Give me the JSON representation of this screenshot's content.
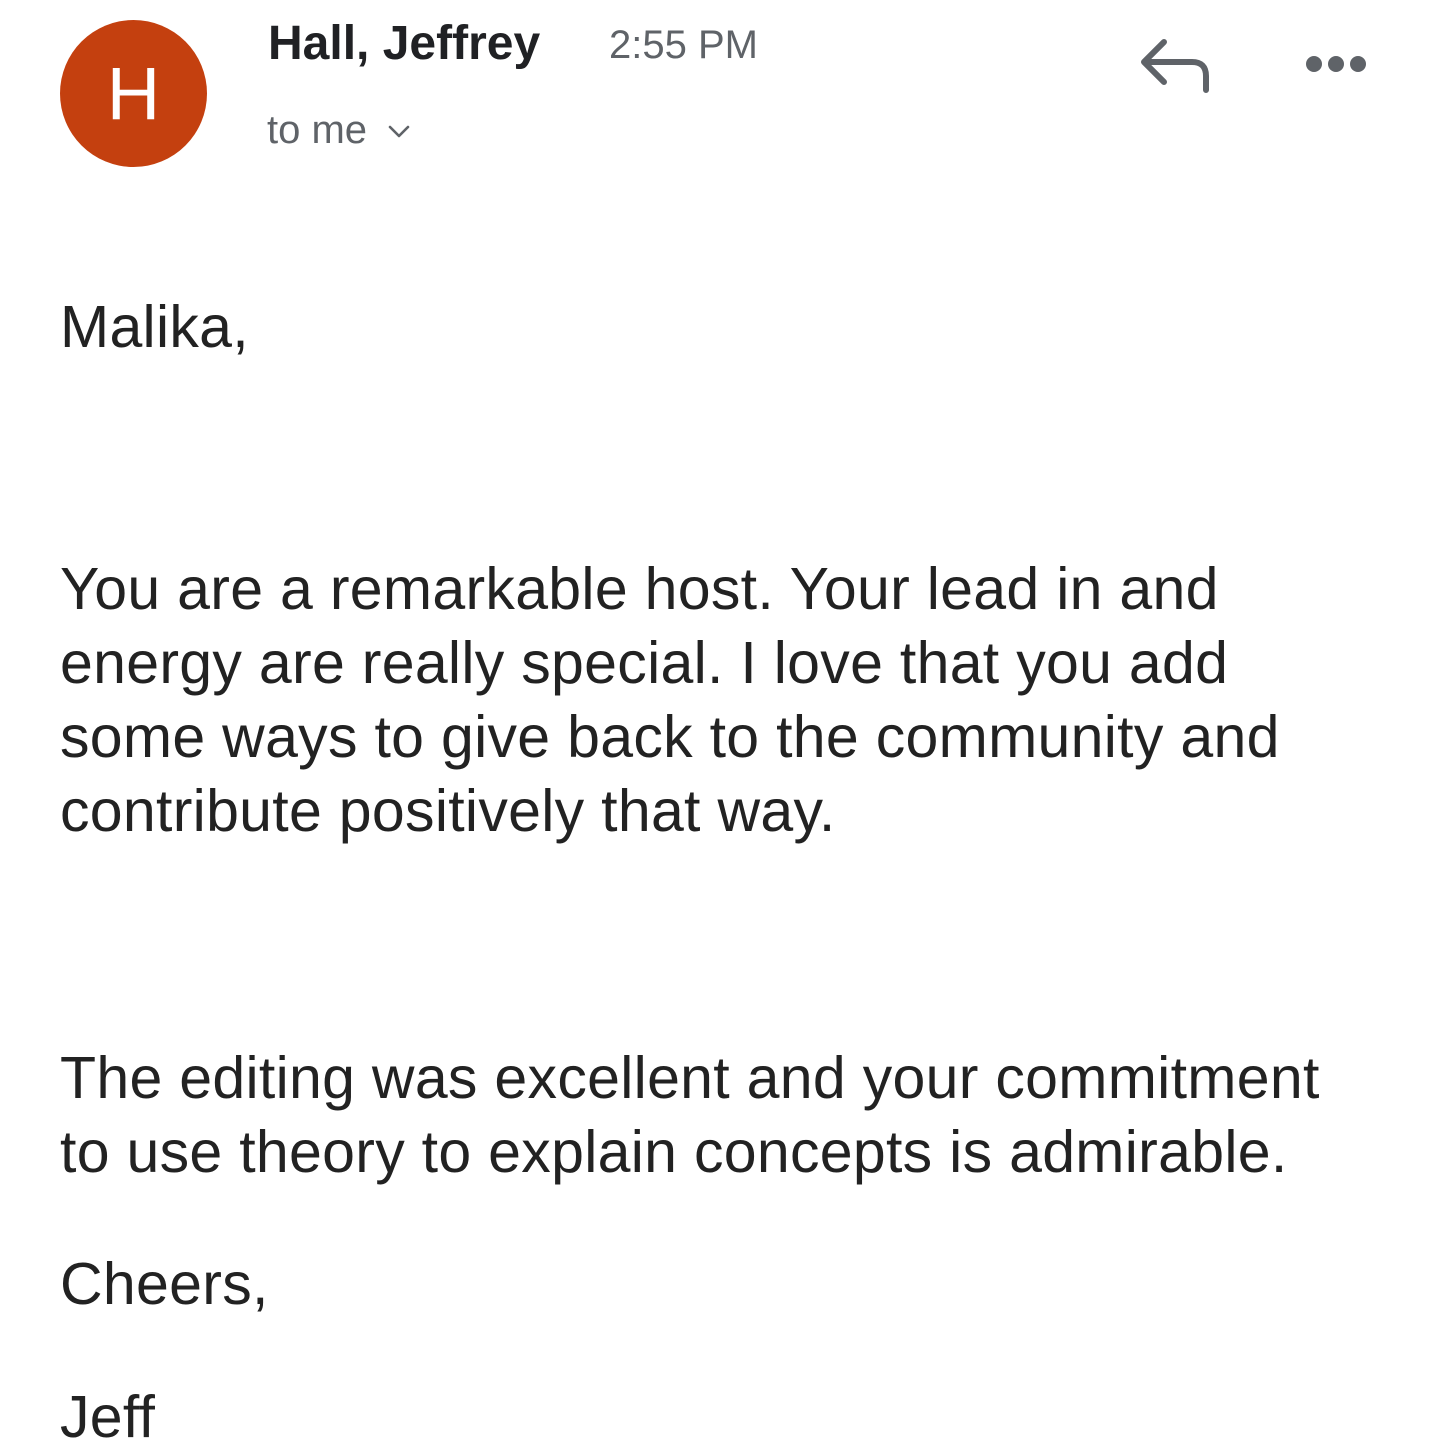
{
  "sender": {
    "avatar_letter": "H",
    "avatar_color": "#c4400f",
    "name": "Hall, Jeffrey",
    "time": "2:55 PM",
    "recipient_label": "to me"
  },
  "actions": {
    "reply_icon": "reply-icon",
    "more_icon": "more-horizontal-icon"
  },
  "message": {
    "greeting": "Malika,",
    "paragraph1_lines": [
      "You are a remarkable host.  Your lead in and",
      "energy are really special.  I love that you add",
      "some ways to give back to the community and",
      "contribute positively that way."
    ],
    "paragraph2_lines": [
      "The editing was excellent and your commitment",
      "to use theory to explain concepts is admirable."
    ],
    "signoff": "Cheers,",
    "signature": "Jeff"
  }
}
